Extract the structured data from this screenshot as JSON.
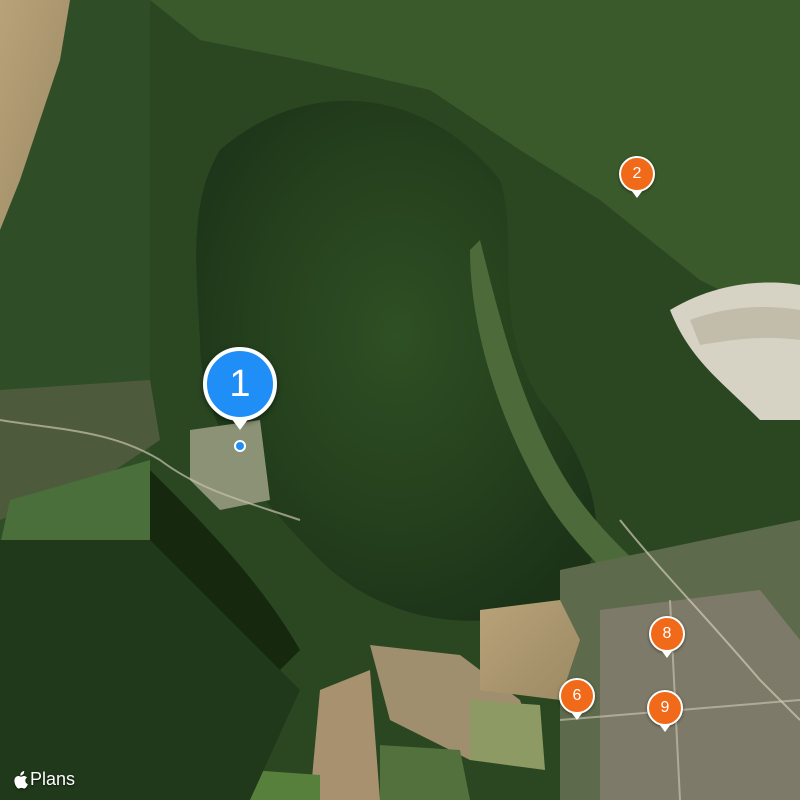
{
  "map": {
    "type": "satellite",
    "attribution": "Plans",
    "attribution_icon": "apple-logo-icon",
    "colors": {
      "pin": "#f06a1a",
      "selected_pin": "#1f8ff7",
      "pin_border": "#ffffff"
    }
  },
  "pins": [
    {
      "label": "1",
      "selected": true
    },
    {
      "label": "2",
      "selected": false
    },
    {
      "label": "6",
      "selected": false
    },
    {
      "label": "8",
      "selected": false
    },
    {
      "label": "9",
      "selected": false
    }
  ]
}
